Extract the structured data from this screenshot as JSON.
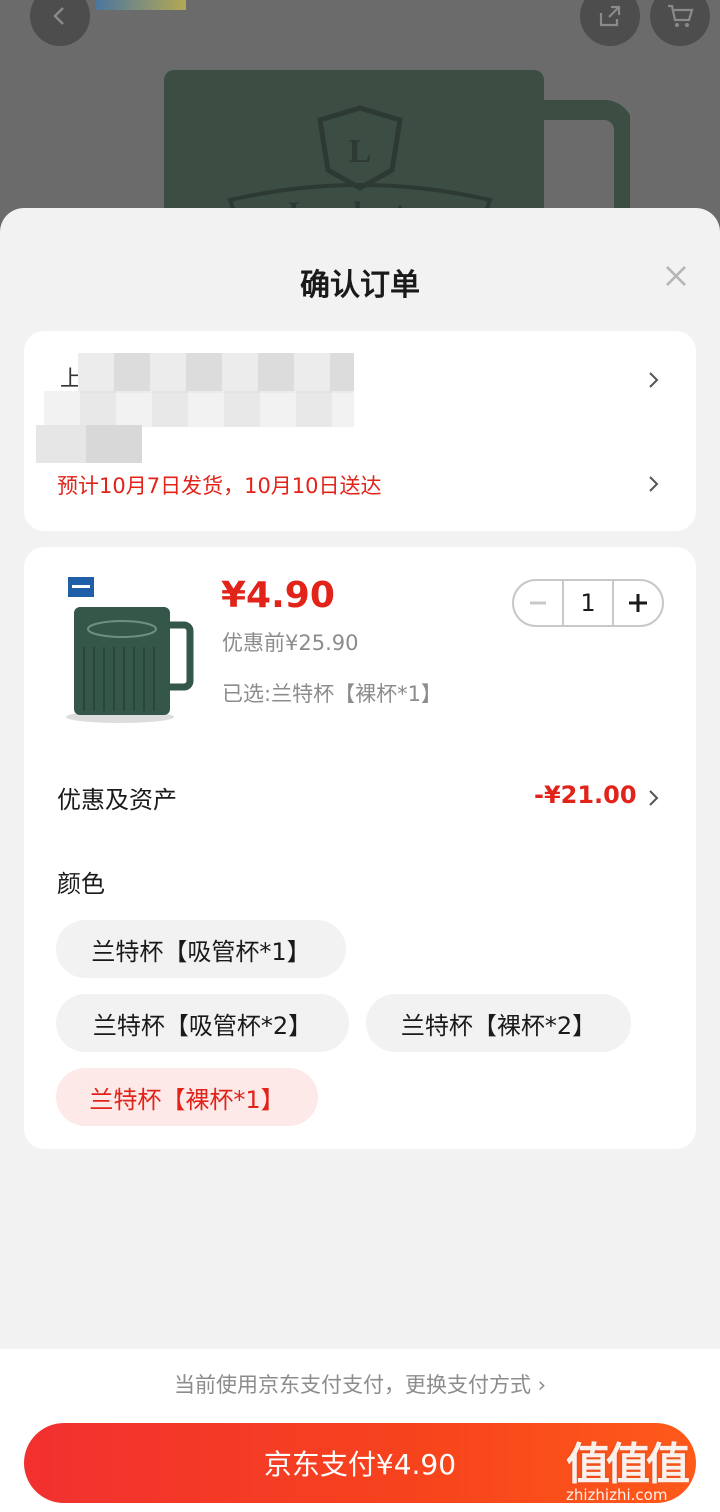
{
  "sheet": {
    "title": "确认订单"
  },
  "address": {
    "prefix": "上",
    "shipping": "预计10月7日发货，10月10日送达"
  },
  "product": {
    "price": "¥4.90",
    "original_price": "优惠前¥25.90",
    "selected": "已选:兰特杯【裸杯*1】",
    "quantity": "1"
  },
  "discount": {
    "label": "优惠及资产",
    "value": "-¥21.00"
  },
  "color": {
    "label": "颜色",
    "options": [
      "兰特杯【吸管杯*1】",
      "兰特杯【吸管杯*2】",
      "兰特杯【裸杯*2】",
      "兰特杯【裸杯*1】"
    ],
    "selected_index": 3
  },
  "payment": {
    "hint": "当前使用京东支付支付，更换支付方式 ›",
    "button": "京东支付¥4.90"
  },
  "watermark": {
    "glyphs": "值值值",
    "url": "zhizhizhi.com"
  },
  "colors": {
    "accent": "#e2231a",
    "selected_chip_bg": "#fde9e8"
  },
  "icons": [
    "back-arrow-icon",
    "share-icon",
    "cart-icon",
    "close-icon",
    "chevron-right-icon",
    "minus-icon",
    "plus-icon"
  ]
}
